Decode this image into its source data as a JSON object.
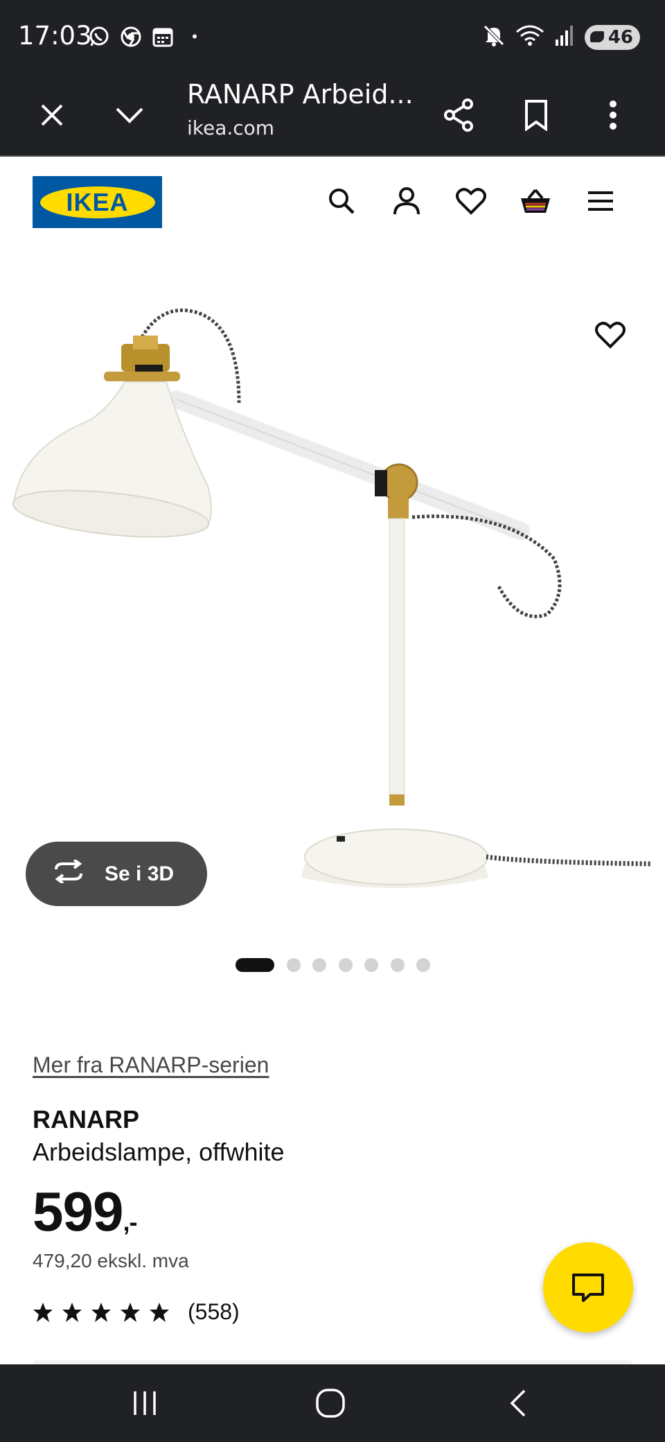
{
  "status_bar": {
    "time": "17:03",
    "dot": "•",
    "battery": "46",
    "icons": [
      "whatsapp-icon",
      "chrome-icon",
      "calendar-icon",
      "mute-icon",
      "wifi-icon",
      "signal-icon",
      "battery-icon"
    ]
  },
  "browser": {
    "tab_title": "RANARP Arbeid...",
    "domain": "ikea.com",
    "icons": [
      "close-icon",
      "chevron-down-icon",
      "share-icon",
      "bookmark-icon",
      "more-icon"
    ]
  },
  "header": {
    "logo_text": "IKEA",
    "brand_colors": {
      "blue": "#0058a3",
      "yellow": "#ffdb00"
    },
    "icons": [
      "search-icon",
      "user-icon",
      "heart-icon",
      "basket-icon",
      "menu-icon"
    ]
  },
  "gallery": {
    "view_3d_label": "Se i 3D",
    "slide_count": 7,
    "active_slide": 1
  },
  "product": {
    "series_link": "Mer fra RANARP-serien",
    "name": "RANARP",
    "description": "Arbeidslampe, offwhite",
    "price": "599",
    "price_suffix": ",-",
    "price_ex_vat": "479,20 ekskl. mva",
    "rating_stars": 5,
    "rating_count": "(558)"
  },
  "chat": {
    "icon": "chat-icon",
    "color": "#ffdb00"
  },
  "nav_bar": {
    "icons": [
      "recents-icon",
      "home-icon",
      "back-icon"
    ]
  }
}
